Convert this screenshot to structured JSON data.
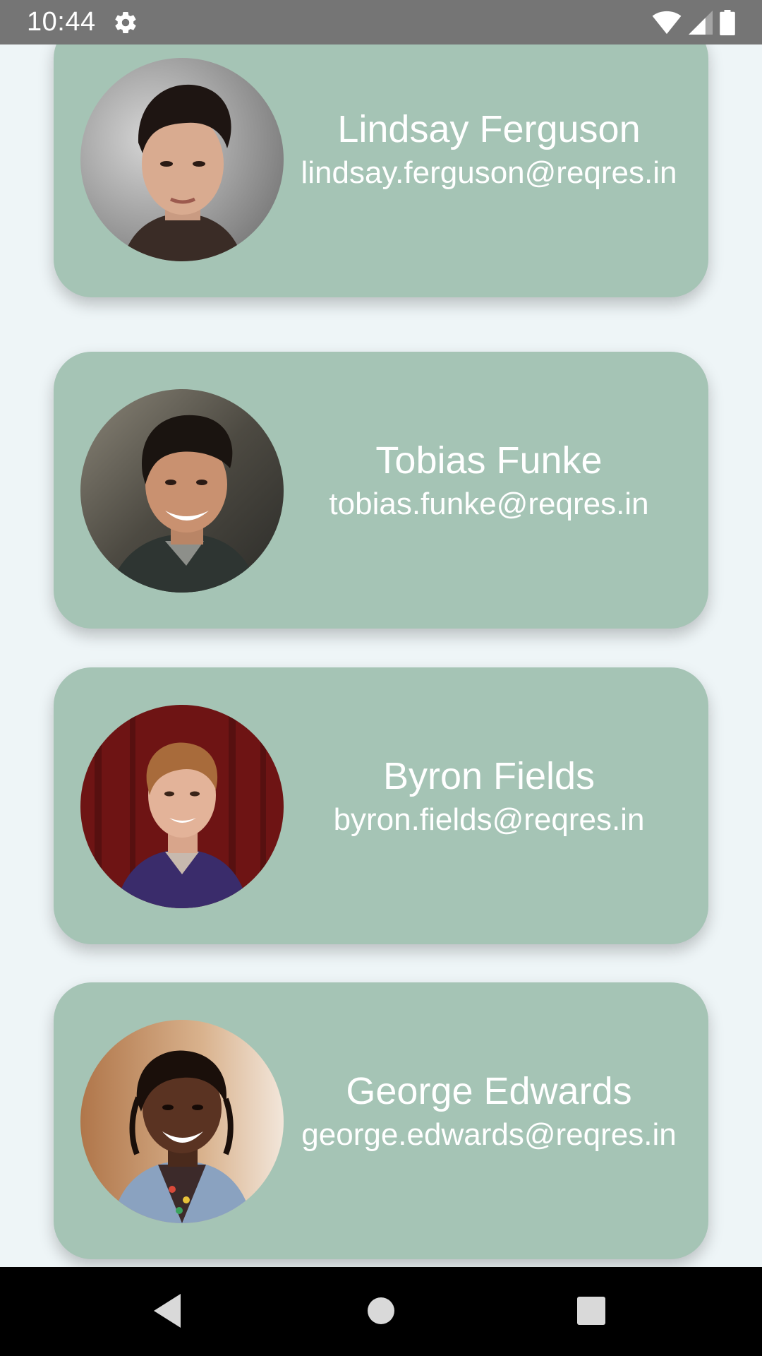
{
  "status_bar": {
    "time": "10:44",
    "icons": [
      "gear-icon",
      "wifi-icon",
      "cell-signal-icon",
      "battery-icon"
    ]
  },
  "colors": {
    "background": "#eef5f7",
    "card": "#a5c4b5",
    "status_bar": "#757575",
    "nav_bar": "#000000",
    "text": "#ffffff"
  },
  "users": [
    {
      "name": "Lindsay Ferguson",
      "email": "lindsay.ferguson@reqres.in"
    },
    {
      "name": "Tobias Funke",
      "email": "tobias.funke@reqres.in"
    },
    {
      "name": "Byron Fields",
      "email": "byron.fields@reqres.in"
    },
    {
      "name": "George Edwards",
      "email": "george.edwards@reqres.in"
    }
  ],
  "nav_bar": {
    "buttons": [
      "back-icon",
      "home-icon",
      "recents-icon"
    ]
  }
}
